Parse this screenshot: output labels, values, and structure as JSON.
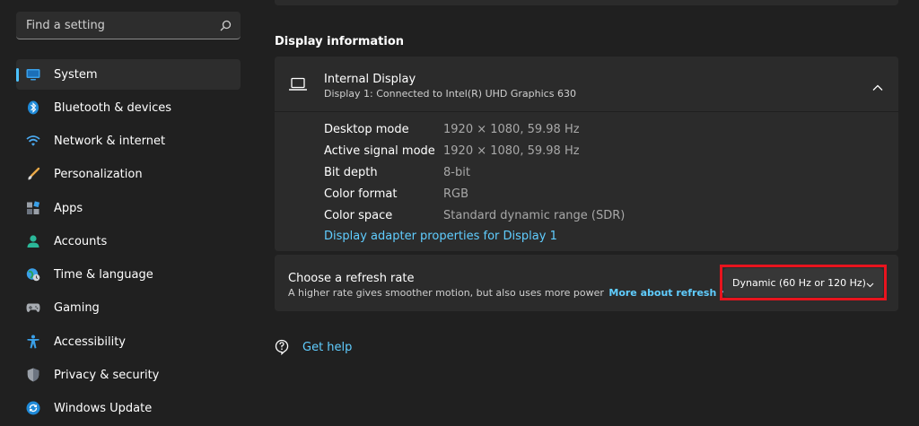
{
  "search": {
    "placeholder": "Find a setting",
    "icon": "search-icon"
  },
  "sidebar": {
    "accent_color": "#4cc2ff",
    "items": [
      {
        "label": "System",
        "icon": "system-icon",
        "selected": true
      },
      {
        "label": "Bluetooth & devices",
        "icon": "bluetooth-icon"
      },
      {
        "label": "Network & internet",
        "icon": "wifi-icon"
      },
      {
        "label": "Personalization",
        "icon": "brush-icon"
      },
      {
        "label": "Apps",
        "icon": "apps-icon"
      },
      {
        "label": "Accounts",
        "icon": "person-icon"
      },
      {
        "label": "Time & language",
        "icon": "globe-clock-icon"
      },
      {
        "label": "Gaming",
        "icon": "gamepad-icon"
      },
      {
        "label": "Accessibility",
        "icon": "accessibility-icon"
      },
      {
        "label": "Privacy & security",
        "icon": "shield-icon"
      },
      {
        "label": "Windows Update",
        "icon": "update-icon"
      }
    ]
  },
  "main": {
    "section_title": "Display information",
    "display": {
      "name": "Internal Display",
      "subtitle": "Display 1: Connected to Intel(R) UHD Graphics 630",
      "properties": [
        {
          "label": "Desktop mode",
          "value": "1920 × 1080, 59.98 Hz"
        },
        {
          "label": "Active signal mode",
          "value": "1920 × 1080, 59.98 Hz"
        },
        {
          "label": "Bit depth",
          "value": "8-bit"
        },
        {
          "label": "Color format",
          "value": "RGB"
        },
        {
          "label": "Color space",
          "value": "Standard dynamic range (SDR)"
        }
      ],
      "adapter_link": "Display adapter properties for Display 1"
    },
    "refresh": {
      "title": "Choose a refresh rate",
      "description": "A higher rate gives smoother motion, but also uses more power",
      "link": "More about refresh rate",
      "selected": "Dynamic (60 Hz or 120 Hz)",
      "highlight_color": "#e8141e"
    },
    "help": {
      "label": "Get help"
    }
  }
}
